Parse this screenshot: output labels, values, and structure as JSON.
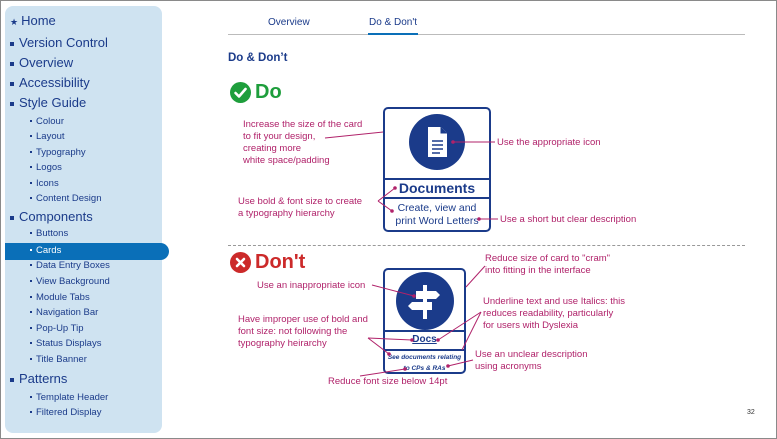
{
  "sidebar": {
    "home": "Home",
    "items": [
      "Version Control",
      "Overview",
      "Accessibility",
      "Style Guide"
    ],
    "style_guide_sub": [
      "Colour",
      "Layout",
      "Typography",
      "Logos",
      "Icons",
      "Content Design"
    ],
    "components": "Components",
    "components_sub": [
      "Buttons",
      "Cards",
      "Data Entry Boxes",
      "View Background",
      "Module Tabs",
      "Navigation Bar",
      "Pop-Up Tip",
      "Status Displays",
      "Title Banner"
    ],
    "patterns": "Patterns",
    "patterns_sub": [
      "Template Header",
      "Filtered Display"
    ],
    "selected": "Cards"
  },
  "tabs": [
    {
      "label": "Overview"
    },
    {
      "label": "Do & Don't",
      "active": true
    }
  ],
  "heading": "Do & Don’t",
  "do": {
    "title": "Do",
    "icon": "check-circle-icon",
    "card": {
      "icon": "document-icon",
      "title": "Documents",
      "desc1": "Create, view and",
      "desc2": "print Word Letters"
    },
    "annotations": {
      "size": [
        "Increase the size of the card",
        "to fit your design,",
        "creating more",
        "white space/padding"
      ],
      "icon": "Use the appropriate icon",
      "bold": [
        "Use bold & font size to create",
        "a typography hierarchy"
      ],
      "desc": "Use a short but clear description"
    }
  },
  "dont": {
    "title": "Don't",
    "icon": "x-circle-icon",
    "card": {
      "icon": "signpost-icon",
      "title": "Docs",
      "desc1": "See documents relating",
      "desc2": "to CPs & RAs"
    },
    "annotations": {
      "cram": [
        "Reduce size of card to \"cram\"",
        "into fitting in the interface"
      ],
      "icon": "Use an inappropriate icon",
      "underline": [
        "Underline text and use Italics: this",
        "reduces readability, particularly",
        "for users with Dyslexia"
      ],
      "bold": [
        "Have improper use of bold and",
        "font size: not following the",
        "typography heirarchy"
      ],
      "desc": [
        "Use an unclear description",
        "using acronyms"
      ],
      "font": "Reduce font size below 14pt"
    }
  },
  "page_number": "32",
  "colors": {
    "navy": "#1b3b8a",
    "accent": "#0a6fb8",
    "annotation": "#b0226a",
    "do": "#1e9e3c",
    "dont": "#cc2a2a"
  }
}
